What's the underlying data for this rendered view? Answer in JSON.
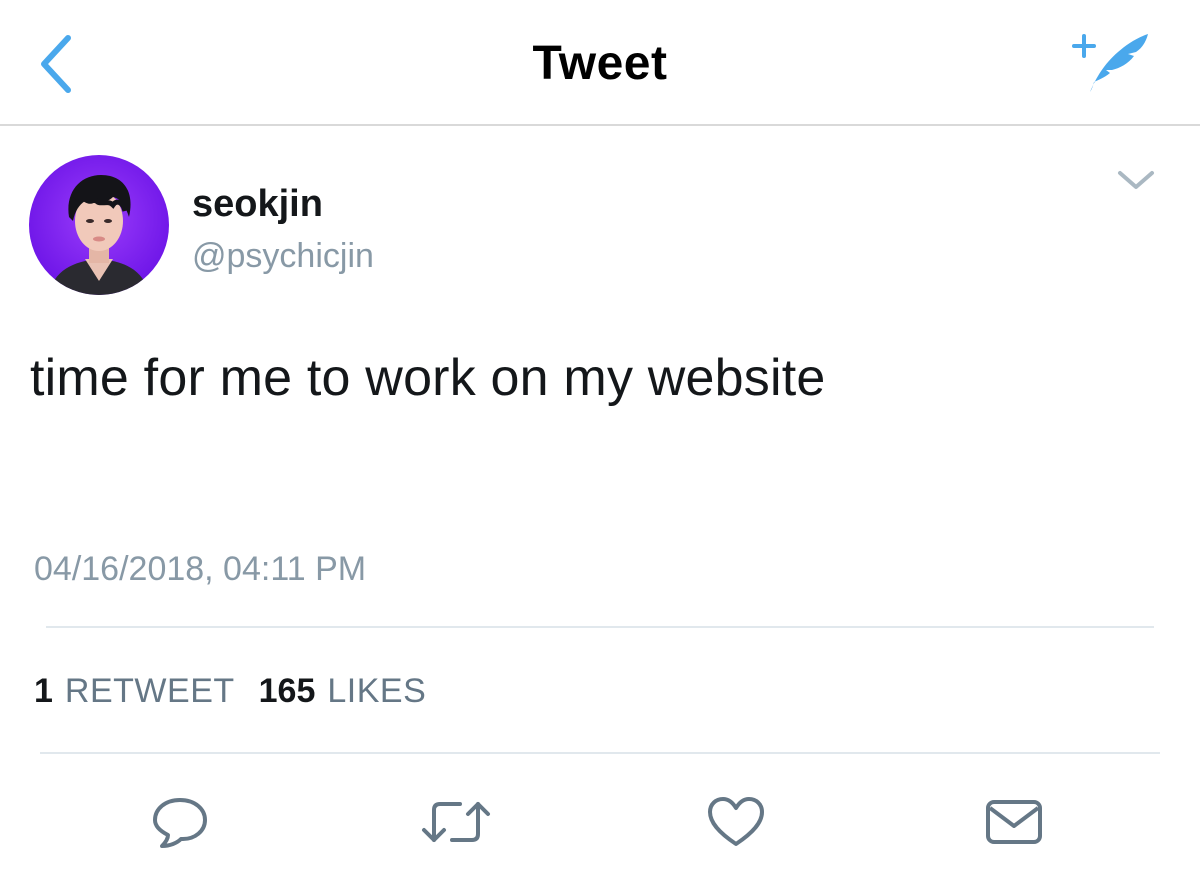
{
  "header": {
    "title": "Tweet",
    "back_icon": "chevron-left-icon",
    "compose_icon": "compose-tweet-icon",
    "accent_color": "#4aa8ec"
  },
  "tweet": {
    "display_name": "seokjin",
    "handle": "@psychicjin",
    "text": "time for me to work on my website",
    "timestamp": "04/16/2018, 04:11 PM",
    "stats": {
      "retweets_count": "1",
      "retweets_label": "RETWEET",
      "likes_count": "165",
      "likes_label": "LIKES"
    }
  },
  "actions": [
    {
      "icon": "reply-icon"
    },
    {
      "icon": "retweet-icon"
    },
    {
      "icon": "like-icon"
    },
    {
      "icon": "direct-message-icon"
    }
  ],
  "colors": {
    "text_primary": "#14171a",
    "text_secondary": "#8899a6",
    "divider": "#e1e8ed",
    "avatar_bg": "#7a1ff0"
  }
}
